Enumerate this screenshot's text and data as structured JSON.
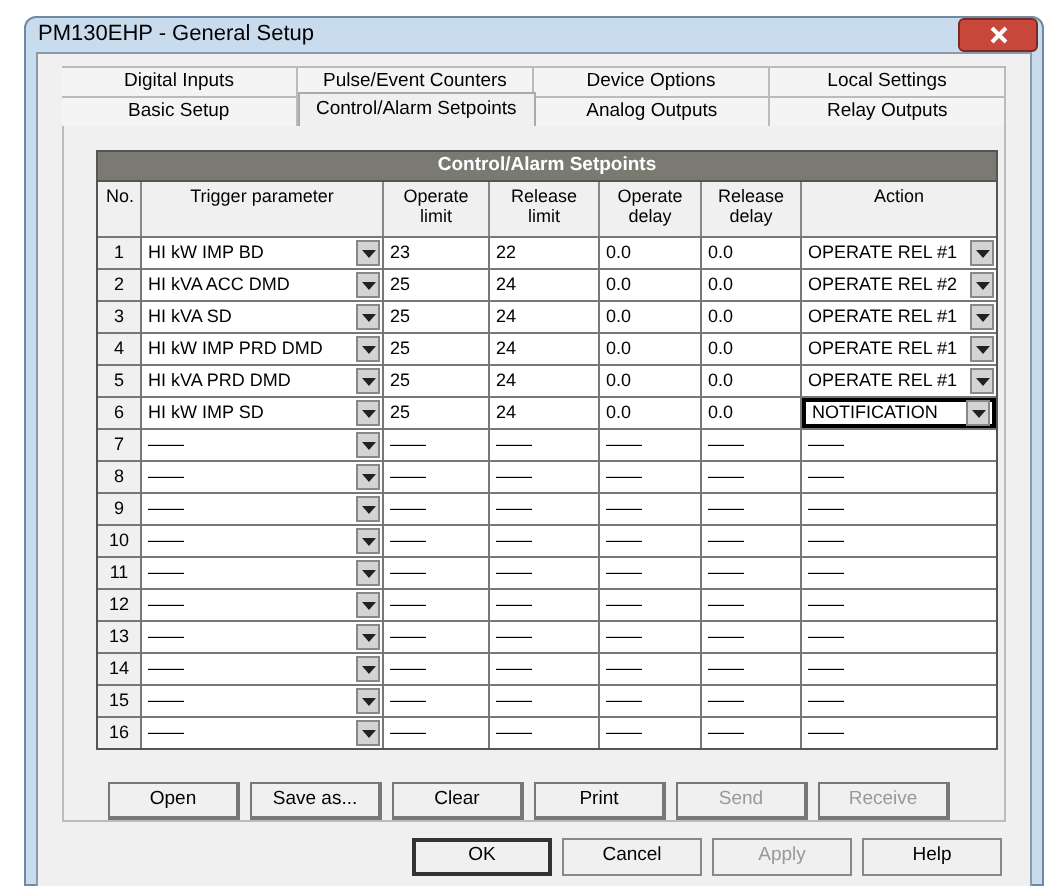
{
  "window": {
    "title": "PM130EHP - General Setup"
  },
  "tab_rows": [
    [
      {
        "label": "Digital Inputs",
        "selected": false
      },
      {
        "label": "Pulse/Event Counters",
        "selected": false
      },
      {
        "label": "Device Options",
        "selected": false
      },
      {
        "label": "Local Settings",
        "selected": false
      }
    ],
    [
      {
        "label": "Basic Setup",
        "selected": false
      },
      {
        "label": "Control/Alarm Setpoints",
        "selected": true
      },
      {
        "label": "Analog Outputs",
        "selected": false
      },
      {
        "label": "Relay Outputs",
        "selected": false
      }
    ]
  ],
  "table": {
    "title": "Control/Alarm Setpoints",
    "columns": [
      "No.",
      "Trigger parameter",
      "Operate limit",
      "Release limit",
      "Operate delay",
      "Release delay",
      "Action"
    ],
    "rows": [
      {
        "kind": "set",
        "no": "1",
        "trigger": "HI kW IMP BD",
        "operate_limit": "23",
        "release_limit": "22",
        "operate_delay": "0.0",
        "release_delay": "0.0",
        "action": "OPERATE REL #1",
        "focused": false
      },
      {
        "kind": "set",
        "no": "2",
        "trigger": "HI kVA ACC DMD",
        "operate_limit": "25",
        "release_limit": "24",
        "operate_delay": "0.0",
        "release_delay": "0.0",
        "action": "OPERATE REL #2",
        "focused": false
      },
      {
        "kind": "set",
        "no": "3",
        "trigger": "HI kVA SD",
        "operate_limit": "25",
        "release_limit": "24",
        "operate_delay": "0.0",
        "release_delay": "0.0",
        "action": "OPERATE REL #1",
        "focused": false
      },
      {
        "kind": "set",
        "no": "4",
        "trigger": "HI kW IMP PRD DMD",
        "operate_limit": "25",
        "release_limit": "24",
        "operate_delay": "0.0",
        "release_delay": "0.0",
        "action": "OPERATE REL #1",
        "focused": false
      },
      {
        "kind": "set",
        "no": "5",
        "trigger": "HI kVA PRD DMD",
        "operate_limit": "25",
        "release_limit": "24",
        "operate_delay": "0.0",
        "release_delay": "0.0",
        "action": "OPERATE REL #1",
        "focused": false
      },
      {
        "kind": "set",
        "no": "6",
        "trigger": "HI kW IMP SD",
        "operate_limit": "25",
        "release_limit": "24",
        "operate_delay": "0.0",
        "release_delay": "0.0",
        "action": "NOTIFICATION",
        "focused": true
      },
      {
        "kind": "empty",
        "no": "7",
        "trigger": "——",
        "operate_limit": "——",
        "release_limit": "——",
        "operate_delay": "——",
        "release_delay": "——",
        "action": "——",
        "focused": false
      },
      {
        "kind": "empty",
        "no": "8",
        "trigger": "——",
        "operate_limit": "——",
        "release_limit": "——",
        "operate_delay": "——",
        "release_delay": "——",
        "action": "——",
        "focused": false
      },
      {
        "kind": "empty",
        "no": "9",
        "trigger": "——",
        "operate_limit": "——",
        "release_limit": "——",
        "operate_delay": "——",
        "release_delay": "——",
        "action": "——",
        "focused": false
      },
      {
        "kind": "empty",
        "no": "10",
        "trigger": "——",
        "operate_limit": "——",
        "release_limit": "——",
        "operate_delay": "——",
        "release_delay": "——",
        "action": "——",
        "focused": false
      },
      {
        "kind": "empty",
        "no": "11",
        "trigger": "——",
        "operate_limit": "——",
        "release_limit": "——",
        "operate_delay": "——",
        "release_delay": "——",
        "action": "——",
        "focused": false
      },
      {
        "kind": "empty",
        "no": "12",
        "trigger": "——",
        "operate_limit": "——",
        "release_limit": "——",
        "operate_delay": "——",
        "release_delay": "——",
        "action": "——",
        "focused": false
      },
      {
        "kind": "empty",
        "no": "13",
        "trigger": "——",
        "operate_limit": "——",
        "release_limit": "——",
        "operate_delay": "——",
        "release_delay": "——",
        "action": "——",
        "focused": false
      },
      {
        "kind": "empty",
        "no": "14",
        "trigger": "——",
        "operate_limit": "——",
        "release_limit": "——",
        "operate_delay": "——",
        "release_delay": "——",
        "action": "——",
        "focused": false
      },
      {
        "kind": "empty",
        "no": "15",
        "trigger": "——",
        "operate_limit": "——",
        "release_limit": "——",
        "operate_delay": "——",
        "release_delay": "——",
        "action": "——",
        "focused": false
      },
      {
        "kind": "empty",
        "no": "16",
        "trigger": "——",
        "operate_limit": "——",
        "release_limit": "——",
        "operate_delay": "——",
        "release_delay": "——",
        "action": "——",
        "focused": false
      }
    ]
  },
  "file_buttons": [
    {
      "label": "Open",
      "disabled": false
    },
    {
      "label": "Save as...",
      "disabled": false
    },
    {
      "label": "Clear",
      "disabled": false
    },
    {
      "label": "Print",
      "disabled": false
    },
    {
      "label": "Send",
      "disabled": true
    },
    {
      "label": "Receive",
      "disabled": true
    }
  ],
  "dialog_buttons": [
    {
      "label": "OK",
      "disabled": false,
      "default": true
    },
    {
      "label": "Cancel",
      "disabled": false,
      "default": false
    },
    {
      "label": "Apply",
      "disabled": true,
      "default": false
    },
    {
      "label": "Help",
      "disabled": false,
      "default": false
    }
  ]
}
